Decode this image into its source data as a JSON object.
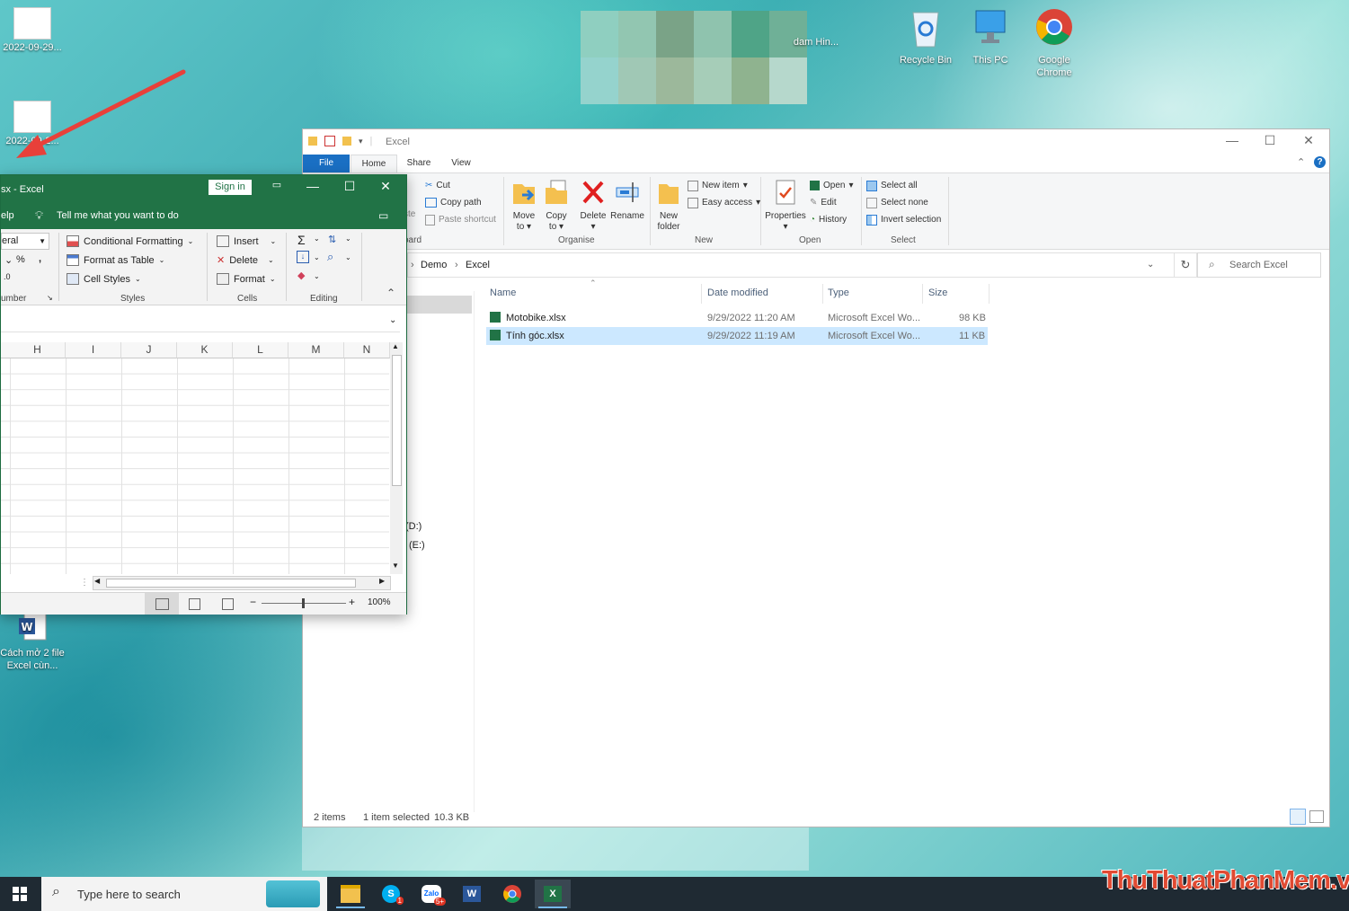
{
  "desktop": {
    "icons": [
      {
        "label": "2022-09-29...",
        "icon": "image-thumbnail-icon"
      },
      {
        "label": "2022-09-2...",
        "icon": "image-thumbnail-icon"
      },
      {
        "label": "dam Hin...",
        "icon": "folder-icon"
      },
      {
        "label": "Recycle Bin",
        "icon": "recycle-bin-icon"
      },
      {
        "label": "This PC",
        "icon": "computer-icon"
      },
      {
        "label": "Google Chrome",
        "icon": "chrome-icon"
      },
      {
        "label": "Cách mở 2 file Excel cùn...",
        "icon": "word-document-icon"
      }
    ]
  },
  "explorer": {
    "title": "Excel",
    "tabs": {
      "file": "File",
      "home": "Home",
      "share": "Share",
      "view": "View"
    },
    "clipboard": {
      "cut": "Cut",
      "copy_path": "Copy path",
      "paste_shortcut": "Paste shortcut",
      "paste_partial": "ste",
      "group_partial": "oard"
    },
    "organise": {
      "move_to": "Move",
      "move_to2": "to",
      "copy_to": "Copy",
      "copy_to2": "to",
      "delete": "Delete",
      "rename": "Rename",
      "label": "Organise"
    },
    "new": {
      "new_folder": "New",
      "new_folder2": "folder",
      "new_item": "New item",
      "easy_access": "Easy access",
      "label": "New"
    },
    "open": {
      "properties": "Properties",
      "open": "Open",
      "edit": "Edit",
      "history": "History",
      "label": "Open"
    },
    "select": {
      "select_all": "Select all",
      "select_none": "Select none",
      "invert": "Invert selection",
      "label": "Select"
    },
    "address": {
      "crumb1": "Demo",
      "crumb2": "Excel"
    },
    "search_placeholder": "Search Excel",
    "columns": {
      "name": "Name",
      "date": "Date modified",
      "type": "Type",
      "size": "Size"
    },
    "files": [
      {
        "name": "Motobike.xlsx",
        "date": "9/29/2022 11:20 AM",
        "type": "Microsoft Excel Wo...",
        "size": "98 KB",
        "selected": false
      },
      {
        "name": "Tính góc.xlsx",
        "date": "9/29/2022 11:19 AM",
        "type": "Microsoft Excel Wo...",
        "size": "11 KB",
        "selected": true
      }
    ],
    "nav_partial": {
      "d": "(D:)",
      "e": "(E:)"
    },
    "status": {
      "items": "2 items",
      "selected": "1 item selected",
      "size": "10.3 KB"
    }
  },
  "excel": {
    "title": "sx  -  Excel",
    "sign_in": "Sign in",
    "help_partial": "elp",
    "tell_me": "Tell me what you want to do",
    "number_format_partial": "eral",
    "percent": "%",
    "comma": ",",
    "number_label_partial": "umber",
    "styles": {
      "conditional": "Conditional Formatting",
      "table": "Format as Table",
      "cell": "Cell Styles",
      "label": "Styles"
    },
    "cells": {
      "insert": "Insert",
      "delete": "Delete",
      "format": "Format",
      "label": "Cells"
    },
    "editing_label": "Editing",
    "columns": [
      "H",
      "I",
      "J",
      "K",
      "L",
      "M",
      "N"
    ],
    "zoom": "100%"
  },
  "taskbar": {
    "search_placeholder": "Type here to search",
    "apps": [
      "file-explorer-icon",
      "skype-icon",
      "zalo-icon",
      "word-icon",
      "chrome-icon",
      "excel-icon"
    ],
    "badges": {
      "skype": "1",
      "zalo": "5+"
    }
  },
  "watermark": "ThuThuatPhanMem.vn",
  "colors": {
    "excel_green": "#217346",
    "explorer_blue": "#1a6fc3",
    "selection": "#cce8ff",
    "annotation_arrow": "#e8403a"
  }
}
